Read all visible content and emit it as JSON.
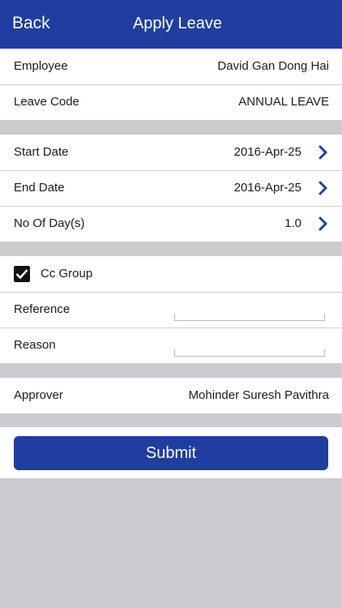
{
  "header": {
    "back_label": "Back",
    "title": "Apply Leave"
  },
  "info": {
    "employee_label": "Employee",
    "employee_value": "David Gan Dong Hai",
    "leave_code_label": "Leave Code",
    "leave_code_value": "ANNUAL LEAVE"
  },
  "dates": {
    "start_label": "Start Date",
    "start_value": "2016-Apr-25",
    "end_label": "End Date",
    "end_value": "2016-Apr-25",
    "days_label": "No Of Day(s)",
    "days_value": "1.0"
  },
  "details": {
    "cc_group_label": "Cc Group",
    "cc_group_checked": true,
    "reference_label": "Reference",
    "reference_value": "",
    "reason_label": "Reason",
    "reason_value": ""
  },
  "approver": {
    "label": "Approver",
    "value": "Mohinder Suresh Pavithra"
  },
  "submit_label": "Submit",
  "icons": {
    "chevron": "chevron-right-icon",
    "check": "checkmark-icon"
  },
  "colors": {
    "brand": "#1f3ea0",
    "background": "#cbcbd0"
  }
}
